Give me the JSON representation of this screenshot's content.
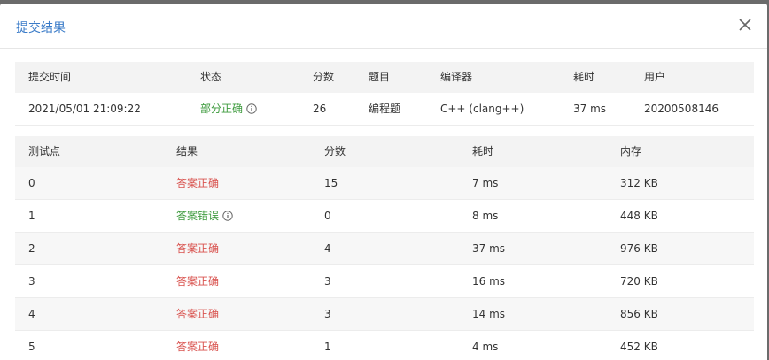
{
  "modal": {
    "title": "提交结果"
  },
  "summary": {
    "headers": [
      "提交时间",
      "状态",
      "分数",
      "题目",
      "编译器",
      "耗时",
      "用户"
    ],
    "row": {
      "time": "2021/05/01 21:09:22",
      "status": "部分正确",
      "score": "26",
      "problem": "编程题",
      "compiler": "C++ (clang++)",
      "elapsed": "37 ms",
      "user": "20200508146"
    }
  },
  "tests": {
    "headers": [
      "测试点",
      "结果",
      "分数",
      "耗时",
      "内存"
    ],
    "rows": [
      {
        "id": "0",
        "result": "答案正确",
        "score": "15",
        "time": "7 ms",
        "memory": "312 KB"
      },
      {
        "id": "1",
        "result": "答案错误",
        "score": "0",
        "time": "8 ms",
        "memory": "448 KB"
      },
      {
        "id": "2",
        "result": "答案正确",
        "score": "4",
        "time": "37 ms",
        "memory": "976 KB"
      },
      {
        "id": "3",
        "result": "答案正确",
        "score": "3",
        "time": "16 ms",
        "memory": "720 KB"
      },
      {
        "id": "4",
        "result": "答案正确",
        "score": "3",
        "time": "14 ms",
        "memory": "856 KB"
      },
      {
        "id": "5",
        "result": "答案正确",
        "score": "1",
        "time": "4 ms",
        "memory": "452 KB"
      }
    ]
  },
  "colors": {
    "title": "#3a7bc8",
    "correct": "#d9534f",
    "partial": "#3c9a3c",
    "wrong": "#3c9a3c"
  },
  "icons": {
    "close": "close-icon",
    "info": "info-icon"
  }
}
